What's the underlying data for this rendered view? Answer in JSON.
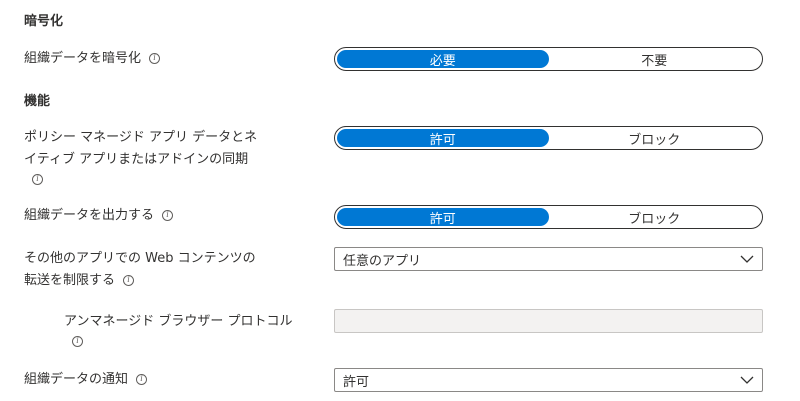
{
  "sections": {
    "encryption_title": "暗号化",
    "function_title": "機能"
  },
  "settings": {
    "encrypt_org_data": {
      "label": "組織データを暗号化",
      "options": [
        "必要",
        "不要"
      ],
      "selected": "必要"
    },
    "policy_sync": {
      "label_line1": "ポリシー マネージド アプリ データとネ",
      "label_line2": "イティブ アプリまたはアドインの同期",
      "options": [
        "許可",
        "ブロック"
      ],
      "selected": "許可"
    },
    "save_output": {
      "label": "組織データを出力する",
      "options": [
        "許可",
        "ブロック"
      ],
      "selected": "許可"
    },
    "web_transfer": {
      "label_line1": "その他のアプリでの Web コンテンツの",
      "label_line2": "転送を制限する",
      "value": "任意のアプリ"
    },
    "unmanaged_browser": {
      "label": "アンマネージド ブラウザー プロトコル",
      "value": ""
    },
    "org_notification": {
      "label": "組織データの通知",
      "value": "許可"
    }
  },
  "icons": {
    "info": "info-icon",
    "dropdown": "chevron-down-icon"
  },
  "colors": {
    "accent": "#0078d4",
    "text": "#323130"
  }
}
